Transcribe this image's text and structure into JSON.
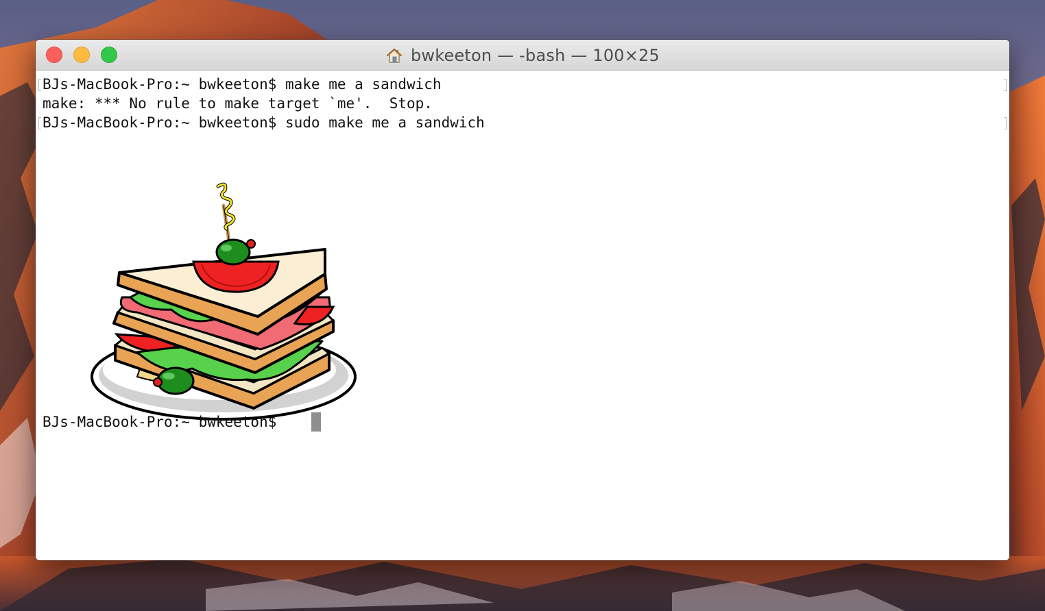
{
  "window": {
    "title": "bwkeeton — -bash — 100×25",
    "title_icon": "home-icon"
  },
  "terminal": {
    "lines": [
      "BJs-MacBook-Pro:~ bwkeeton$ make me a sandwich",
      "make: *** No rule to make target `me'.  Stop.",
      "BJs-MacBook-Pro:~ bwkeeton$ sudo make me a sandwich"
    ],
    "prompt": "BJs-MacBook-Pro:~ bwkeeton$ ",
    "illustration": "sandwich-illustration"
  },
  "colors": {
    "close": "#fc605c",
    "minimize": "#fdbc40",
    "zoom": "#34c84a",
    "terminal_background": "#ffffff",
    "terminal_text": "#111111",
    "cursor": "#8e8e8e"
  }
}
